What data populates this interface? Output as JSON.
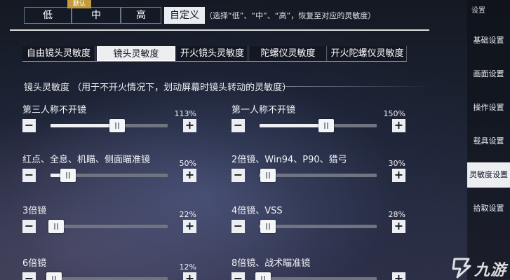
{
  "presets": {
    "default_badge": "默认",
    "buttons": [
      {
        "label": "低",
        "active": false
      },
      {
        "label": "中",
        "active": false
      },
      {
        "label": "高",
        "active": false
      },
      {
        "label": "自定义",
        "active": true
      }
    ],
    "hint": "（选择“低”、“中”、“高”，恢复至对应的灵敏度）"
  },
  "tabs": [
    {
      "label": "自由镜头灵敏度",
      "active": false
    },
    {
      "label": "镜头灵敏度",
      "active": true
    },
    {
      "label": "开火镜头灵敏度",
      "active": false
    },
    {
      "label": "陀螺仪灵敏度",
      "active": false
    },
    {
      "label": "开火陀螺仪灵敏度",
      "active": false
    }
  ],
  "section": {
    "title": "镜头灵敏度  （用于不开火情况下，划动屏幕时镜头转动的灵敏度）"
  },
  "sliders": [
    {
      "label": "第三人称不开镜",
      "value_text": "113%",
      "level": 0.57
    },
    {
      "label": "第一人称不开镜",
      "value_text": "150%",
      "level": 0.57
    },
    {
      "label": "红点、全息、机瞄、侧面瞄准镜",
      "value_text": "50%",
      "level": 0.15
    },
    {
      "label": "2倍镜、Win94、P90、猎弓",
      "value_text": "30%",
      "level": 0.07
    },
    {
      "label": "3倍镜",
      "value_text": "22%",
      "level": 0.05
    },
    {
      "label": "4倍镜、VSS",
      "value_text": "28%",
      "level": 0.07
    },
    {
      "label": "6倍镜",
      "value_text": "12%",
      "level": 0.03
    },
    {
      "label": "8倍镜、战术瞄准镜",
      "value_text": "",
      "level": 0.03
    }
  ],
  "sidebar": {
    "top_label": "设置",
    "items": [
      {
        "label": "基础设置",
        "active": false
      },
      {
        "label": "画面设置",
        "active": false
      },
      {
        "label": "操作设置",
        "active": false
      },
      {
        "label": "载具设置",
        "active": false
      },
      {
        "label": "灵敏度设置",
        "active": true
      },
      {
        "label": "拾取设置",
        "active": false
      }
    ]
  },
  "watermark": {
    "text": "九游"
  },
  "icons": {
    "minus": "minus-icon",
    "plus": "plus-icon",
    "logo": "jiuyou-logo-icon"
  },
  "colors": {
    "active_bg": "#eceef2",
    "badge": "#c49b3c"
  }
}
